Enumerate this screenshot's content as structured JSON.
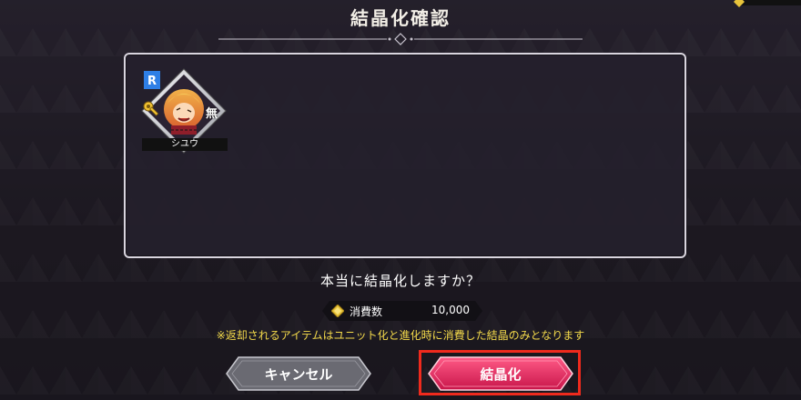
{
  "dialog": {
    "title": "結晶化確認",
    "unit": {
      "name": "シユウ",
      "rarity": "R",
      "element": "無"
    },
    "question": "本当に結晶化しますか？",
    "cost": {
      "label": "消費数",
      "value": "10,000"
    },
    "note": "※返却されるアイテムはユニット化と進化時に消費した結晶のみとなります",
    "buttons": {
      "cancel": "キャンセル",
      "confirm": "結晶化"
    }
  },
  "colors": {
    "highlight": "#ef2a1d",
    "confirm_button": "#e0285a",
    "cancel_button": "#6a6a72",
    "note_text": "#f3d94a",
    "rarity_badge": "#2e7fe6"
  }
}
